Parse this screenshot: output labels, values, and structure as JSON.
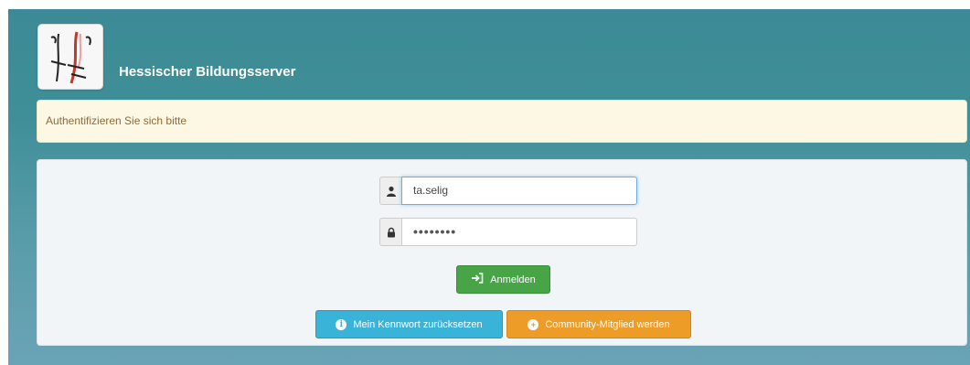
{
  "header": {
    "site_title": "Hessischer Bildungsserver",
    "logo_icon": "hbs-logo-icon"
  },
  "alert": {
    "text": "Authentifizieren Sie sich bitte"
  },
  "login": {
    "username_value": "ta.selig",
    "username_icon": "user-icon",
    "password_value": "••••••••",
    "password_icon": "lock-icon",
    "login_label": "Anmelden",
    "login_icon": "sign-in-icon"
  },
  "actions": {
    "reset_label": "Mein Kennwort zurücksetzen",
    "reset_icon": "info-circle-icon",
    "join_label": "Community-Mitglied werden",
    "join_icon": "plus-circle-icon"
  },
  "colors": {
    "background": "#3f8f98",
    "alert_bg": "#fcf8e3",
    "alert_text": "#8a6d3b",
    "login_button": "#47a447",
    "reset_button": "#39b3d7",
    "join_button": "#ed9c28"
  }
}
